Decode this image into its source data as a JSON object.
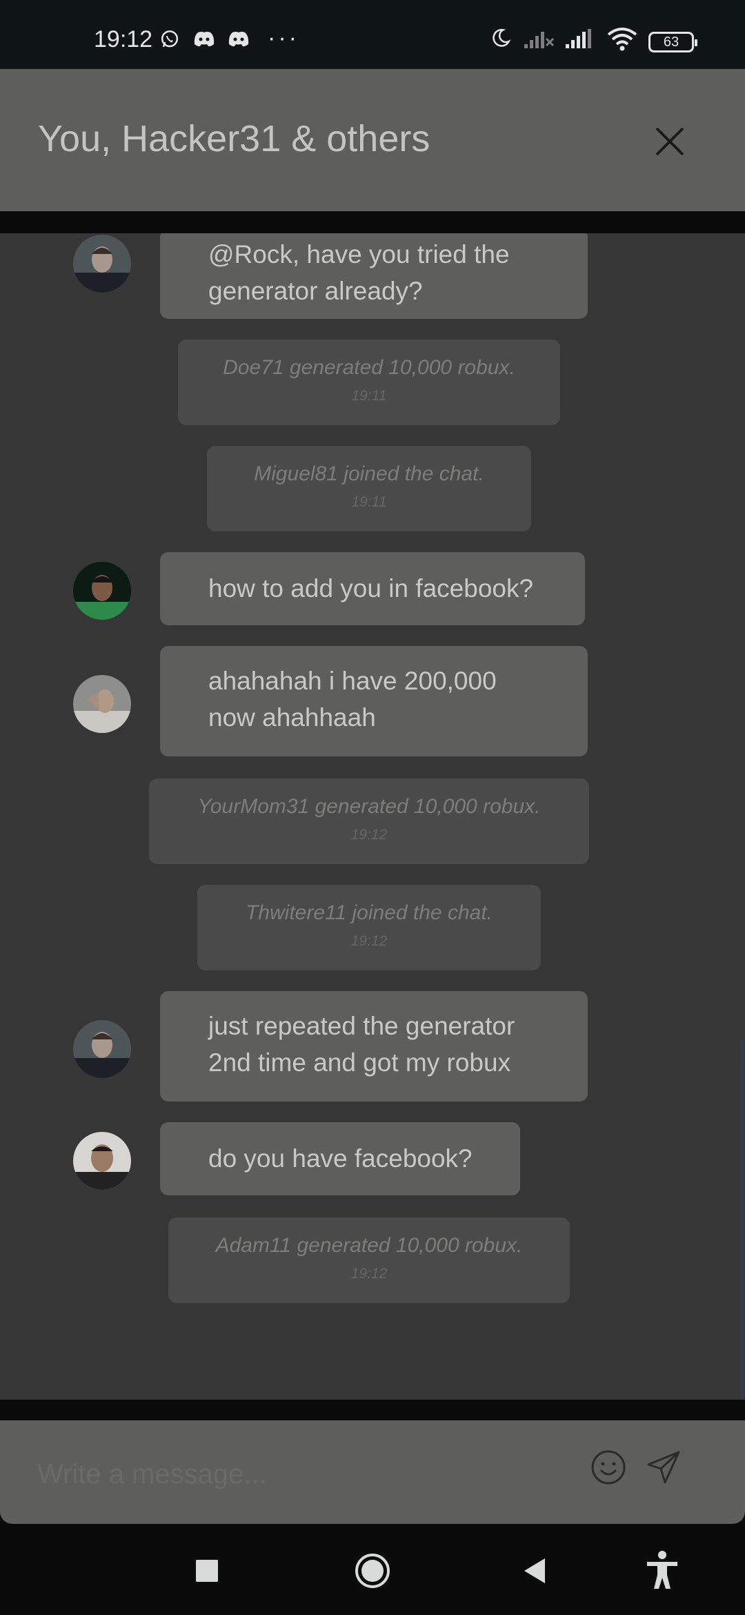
{
  "status_bar": {
    "time": "19:12",
    "dots": "···",
    "battery": "63",
    "icons": [
      "whatsapp-icon",
      "discord-icon",
      "discord-icon",
      "moon-icon",
      "signal-off-icon",
      "signal-icon",
      "wifi-icon",
      "battery-icon"
    ]
  },
  "header": {
    "title": "You, Hacker31 & others",
    "close_icon": "close-icon"
  },
  "messages": [
    {
      "type": "user",
      "text_lines": [
        "@Rock, have you tried the",
        "generator already?"
      ]
    },
    {
      "type": "system",
      "text": "Doe71 generated 10,000 robux.",
      "time": "19:11"
    },
    {
      "type": "system",
      "text": "Miguel81 joined the chat.",
      "time": "19:11"
    },
    {
      "type": "user",
      "text_lines": [
        "how to add you in facebook?"
      ]
    },
    {
      "type": "user",
      "text_lines": [
        "ahahahah i have 200,000",
        "now ahahhaah"
      ]
    },
    {
      "type": "system",
      "text": "YourMom31 generated 10,000 robux.",
      "time": "19:12"
    },
    {
      "type": "system",
      "text": "Thwitere11 joined the chat.",
      "time": "19:12"
    },
    {
      "type": "user",
      "text_lines": [
        "just repeated the generator",
        "2nd time and got my robux"
      ]
    },
    {
      "type": "user",
      "text_lines": [
        "do you have facebook?"
      ]
    },
    {
      "type": "system",
      "text": "Adam11 generated 10,000 robux.",
      "time": "19:12"
    }
  ],
  "composer": {
    "placeholder": "Write a message...",
    "emoji_icon": "emoji-icon",
    "send_icon": "send-icon"
  },
  "nav": [
    "recents-icon",
    "home-icon",
    "back-icon",
    "accessibility-icon"
  ]
}
